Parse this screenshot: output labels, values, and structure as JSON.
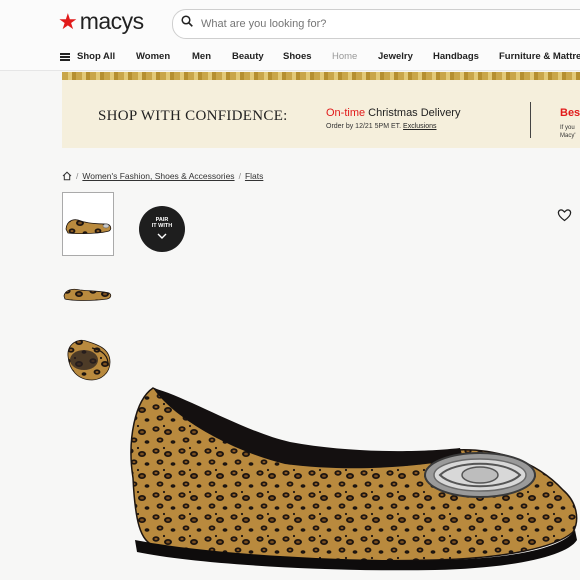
{
  "brand": {
    "name": "macys"
  },
  "search": {
    "placeholder": "What are you looking for?"
  },
  "nav": {
    "shop_all": "Shop All",
    "items": [
      "Women",
      "Men",
      "Beauty",
      "Shoes",
      "Home",
      "Jewelry",
      "Handbags",
      "Furniture & Mattre"
    ]
  },
  "promo": {
    "headline": "SHOP WITH CONFIDENCE:",
    "delivery_prefix": "On-time",
    "delivery_rest": " Christmas Delivery",
    "order_by": "Order by 12/21 5PM ET. ",
    "exclusions": "Exclusions",
    "right_title": "Bes",
    "right_line1": "If you",
    "right_line2": "Macy'"
  },
  "breadcrumb": {
    "sep1": "/",
    "category": "Women's Fashion, Shoes & Accessories",
    "sep2": "/",
    "sub": "Flats"
  },
  "pair_with": {
    "line1": "PAIR",
    "line2": "IT WITH"
  },
  "colors": {
    "accent": "#e11a1a",
    "dark": "#1e1e1e",
    "promo_bg": "#f5efdc"
  }
}
